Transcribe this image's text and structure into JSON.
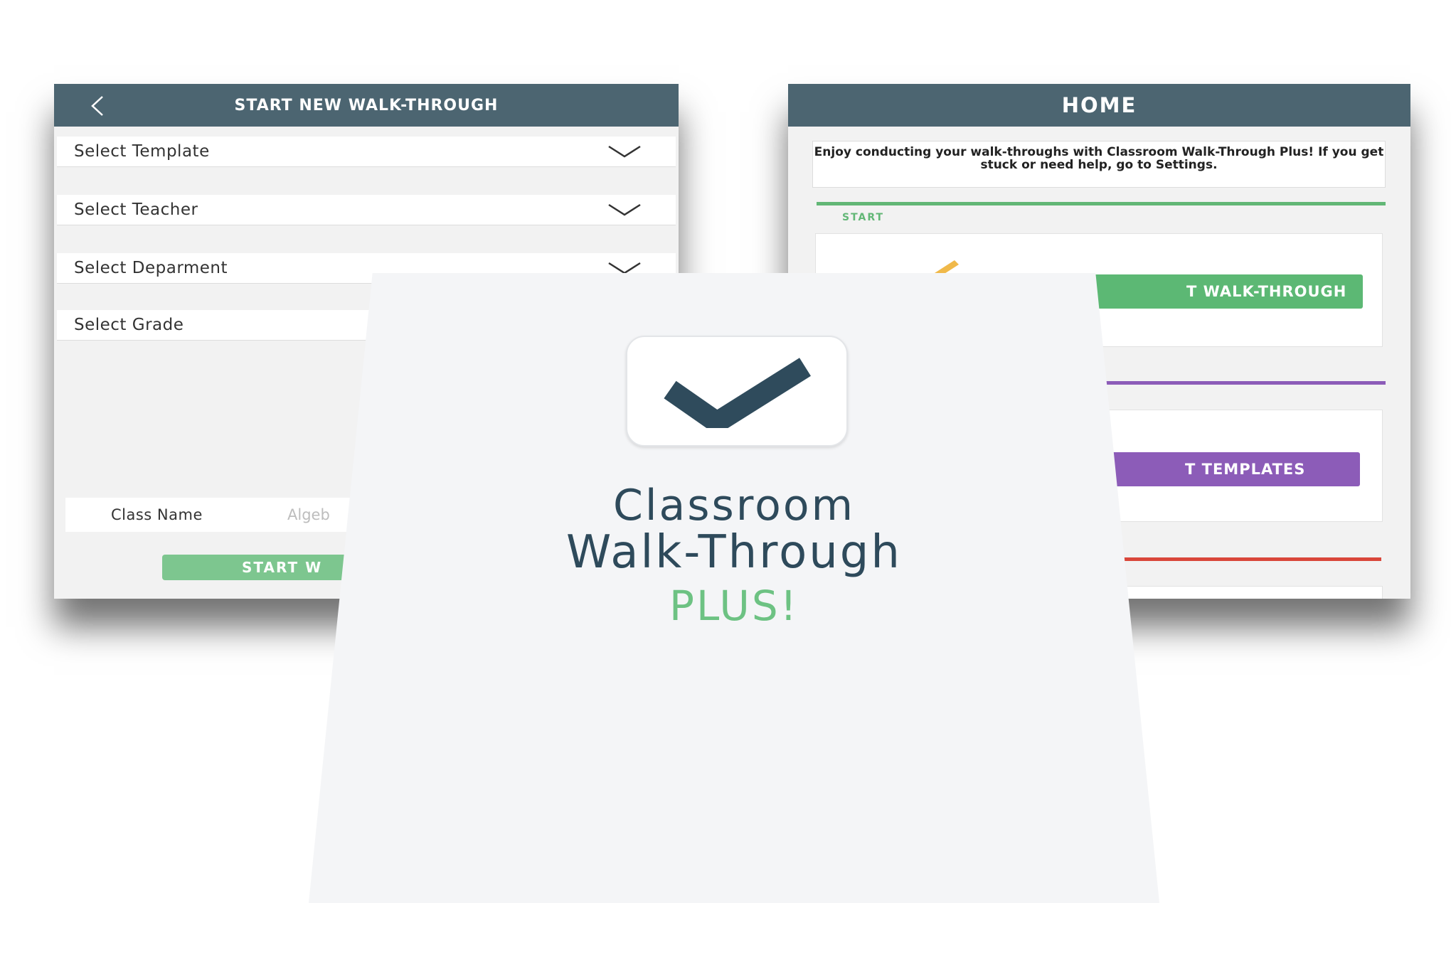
{
  "left_screen": {
    "title": "START NEW WALK-THROUGH",
    "fields": [
      {
        "label": "Select Template"
      },
      {
        "label": "Select Teacher"
      },
      {
        "label": "Select Deparment"
      },
      {
        "label": "Select Grade"
      }
    ],
    "class_name_label": "Class Name",
    "class_name_value": "Algeb",
    "start_button": "START W"
  },
  "right_screen": {
    "title": "HOME",
    "welcome_text": "Enjoy conducting your walk-throughs with Classroom Walk-Through Plus! If you get stuck or need help, go to Settings.",
    "start_section_label": "START",
    "start_button": "T WALK-THROUGH",
    "templates_button": "T TEMPLATES"
  },
  "splash": {
    "line1": "Classroom",
    "line2": "Walk-Through",
    "line3": "PLUS!"
  },
  "colors": {
    "header": "#4c6571",
    "green": "#62b776",
    "purple": "#8c5cb8",
    "red": "#d9463a",
    "title_dark": "#2e4a5b",
    "title_green": "#6dc283"
  },
  "icons": [
    "back-arrow-icon",
    "chevron-down-icon",
    "pencil-icon",
    "checkmark-icon"
  ]
}
